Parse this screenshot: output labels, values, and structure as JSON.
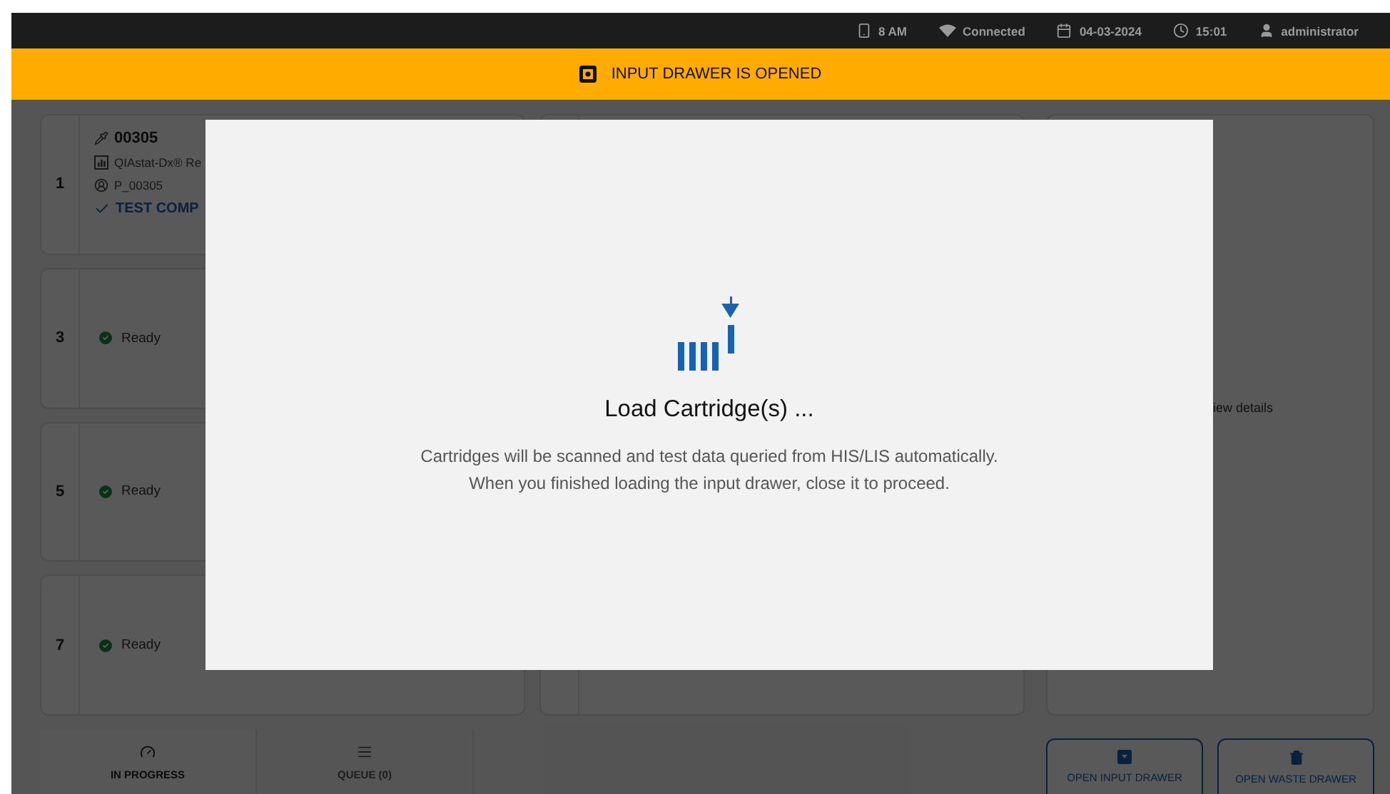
{
  "status_bar": [
    {
      "kind": "phone",
      "text": "8 AM"
    },
    {
      "kind": "wifi",
      "text": "Connected"
    },
    {
      "kind": "date",
      "text": "04-03-2024"
    },
    {
      "kind": "time",
      "text": "15:01"
    },
    {
      "kind": "user",
      "text": "administrator"
    }
  ],
  "banner": {
    "text": "INPUT DRAWER IS OPENED"
  },
  "slots": [
    {
      "kind": "test",
      "number": "1",
      "sample_id": "00305",
      "assay": "QIAstat-Dx® Re",
      "patient": "P_00305",
      "status": "TEST COMP"
    },
    {
      "kind": "ready",
      "number": "3",
      "status": "Ready"
    },
    {
      "kind": "ready",
      "number": "5",
      "status": "Ready"
    },
    {
      "kind": "ready",
      "number": "7",
      "status": "Ready"
    }
  ],
  "details_link": "iew details",
  "nav_tabs": [
    {
      "kind": "progress",
      "label": "IN PROGRESS",
      "selected": true
    },
    {
      "kind": "queue",
      "label": "QUEUE (0)",
      "selected": false
    }
  ],
  "actions": [
    {
      "kind": "input",
      "label": "OPEN INPUT DRAWER"
    },
    {
      "kind": "waste",
      "label": "OPEN WASTE DRAWER"
    }
  ],
  "modal": {
    "title": "Load Cartridge(s) ...",
    "lines": [
      "Cartridges will be scanned and test data queried from HIS/LIS automatically.",
      "When you finished loading the input drawer, close it to proceed."
    ]
  }
}
